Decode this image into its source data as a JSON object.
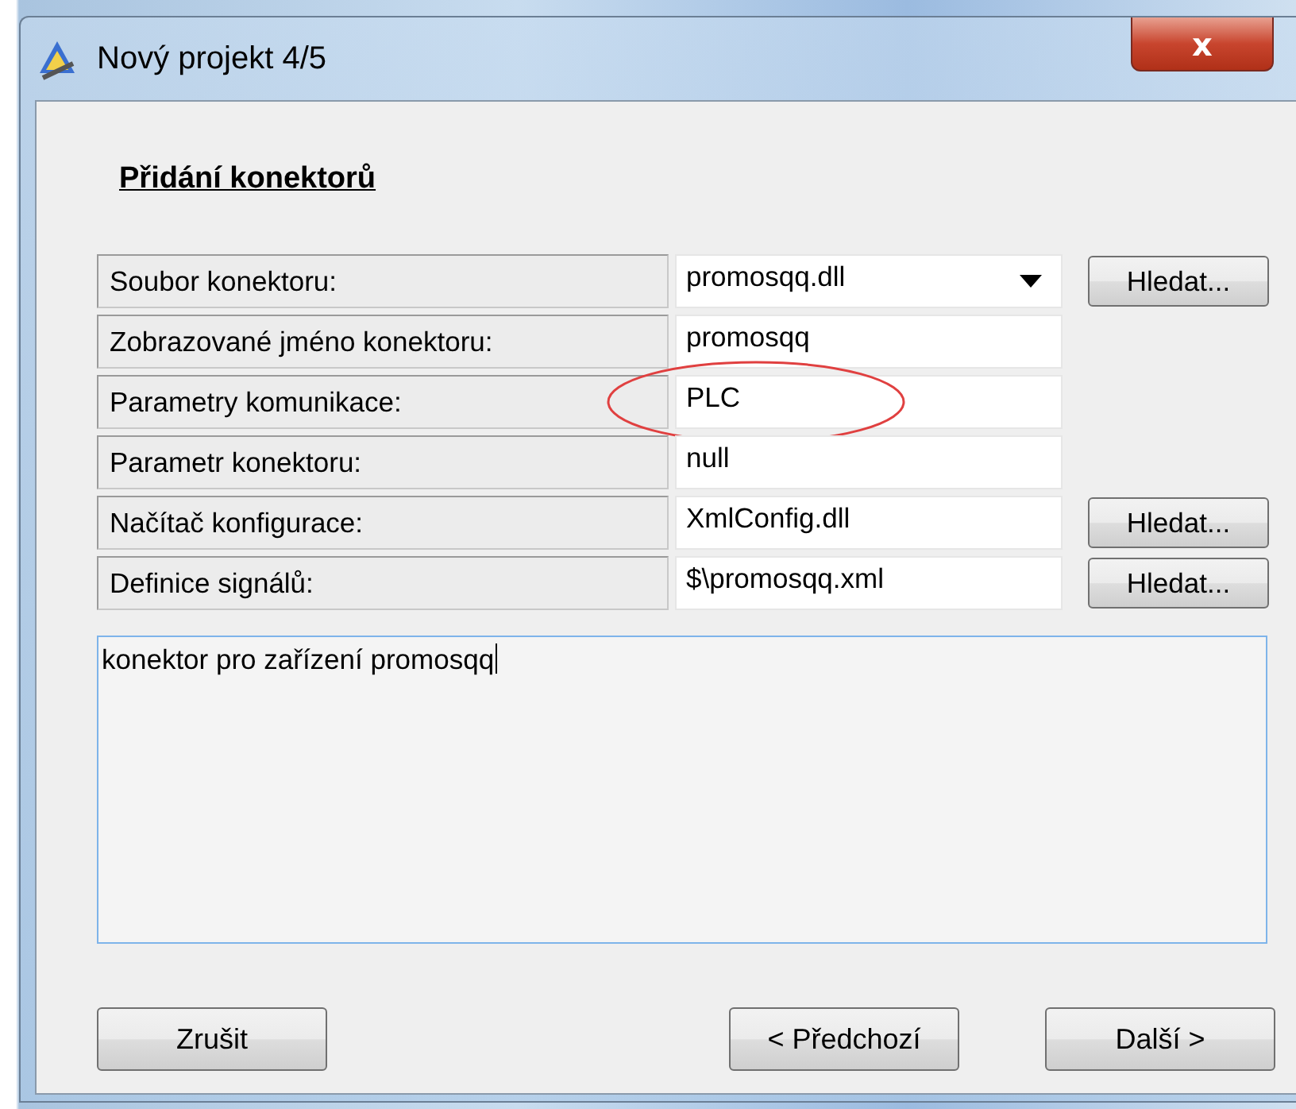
{
  "window": {
    "title": "Nový projekt 4/5",
    "close": "x"
  },
  "heading": "Přidání konektorů",
  "rows": [
    {
      "label": "Soubor konektoru:",
      "kind": "dropdown",
      "value": "promosqq.dll",
      "button": "Hledat...",
      "highlighted": false
    },
    {
      "label": "Zobrazované jméno konektoru:",
      "kind": "text",
      "value": "promosqq",
      "highlighted": false
    },
    {
      "label": "Parametry komunikace:",
      "kind": "text",
      "value": "PLC",
      "highlighted": true
    },
    {
      "label": "Parametr konektoru:",
      "kind": "text",
      "value": "null",
      "highlighted": false
    },
    {
      "label": "Načítač konfigurace:",
      "kind": "text",
      "value": "XmlConfig.dll",
      "button": "Hledat...",
      "highlighted": false
    },
    {
      "label": "Definice signálů:",
      "kind": "text",
      "value": "$\\promosqq.xml",
      "button": "Hledat...",
      "highlighted": false
    }
  ],
  "description": {
    "value": "konektor pro zařízení promosqq",
    "focused": true
  },
  "buttons": [
    {
      "label": "Zrušit",
      "kind": "cancel"
    },
    {
      "label": "< Předchozí",
      "kind": "back"
    },
    {
      "label": "Další >",
      "kind": "next"
    }
  ]
}
